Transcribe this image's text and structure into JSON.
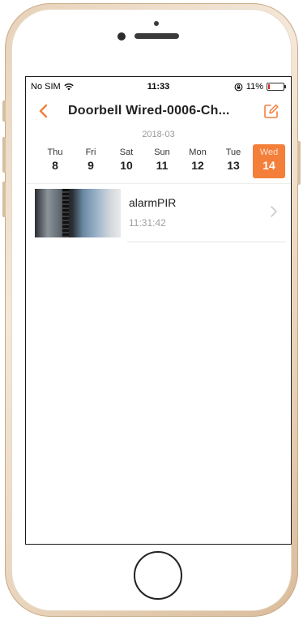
{
  "status_bar": {
    "carrier": "No SIM",
    "time": "11:33",
    "battery_percent": "11%",
    "battery_level": 0.11
  },
  "nav": {
    "title": "Doorbell Wired-0006-Ch...",
    "accent_color": "#f47f3a"
  },
  "calendar": {
    "month": "2018-03",
    "days": [
      {
        "name": "Thu",
        "num": "8",
        "selected": false
      },
      {
        "name": "Fri",
        "num": "9",
        "selected": false
      },
      {
        "name": "Sat",
        "num": "10",
        "selected": false
      },
      {
        "name": "Sun",
        "num": "11",
        "selected": false
      },
      {
        "name": "Mon",
        "num": "12",
        "selected": false
      },
      {
        "name": "Tue",
        "num": "13",
        "selected": false
      },
      {
        "name": "Wed",
        "num": "14",
        "selected": true
      }
    ]
  },
  "events": [
    {
      "title": "alarmPIR",
      "time": "11:31:42"
    }
  ],
  "icons": {
    "back": "chevron-left-icon",
    "edit": "edit-icon",
    "wifi": "wifi-icon",
    "rotation_lock": "rotation-lock-icon",
    "battery": "battery-icon",
    "row_chevron": "chevron-right-icon"
  }
}
